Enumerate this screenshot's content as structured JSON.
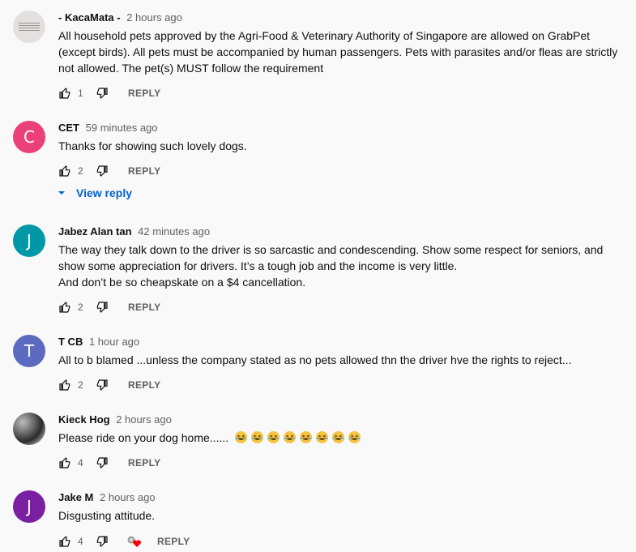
{
  "comments": [
    {
      "author": "- KacaMata -",
      "time": "2 hours ago",
      "text": "All household pets approved by the Agri-Food & Veterinary Authority of Singapore are allowed on GrabPet (except birds). All pets must be accompanied by human passengers. Pets with parasites and/or fleas are strictly not allowed. The pet(s) MUST follow the requirement",
      "likes": "1",
      "avatar": {
        "type": "image-text",
        "color": "#e3e0df"
      }
    },
    {
      "author": "CET",
      "time": "59 minutes ago",
      "text": "Thanks for showing such lovely dogs.",
      "likes": "2",
      "avatar": {
        "type": "letter",
        "letter": "C",
        "color": "#ec407a"
      },
      "view_reply": "View reply"
    },
    {
      "author": "Jabez Alan tan",
      "time": "42 minutes ago",
      "text_lines": [
        "The way they talk down to the driver is so sarcastic and condescending. Show some respect for seniors, and show some appreciation for drivers. It’s a tough job and the income is very little.",
        "And don’t be so cheapskate on a $4 cancellation."
      ],
      "likes": "2",
      "avatar": {
        "type": "letter",
        "letter": "J",
        "color": "#0097a7"
      }
    },
    {
      "author": "T CB",
      "time": "1 hour ago",
      "text": "All to b blamed ...unless the company stated as no pets allowed thn the driver hve the rights to reject...",
      "likes": "2",
      "avatar": {
        "type": "letter",
        "letter": "T",
        "color": "#5c6bc0"
      }
    },
    {
      "author": "Kieck Hog",
      "time": "2 hours ago",
      "text": "Please ride on your dog home......",
      "emoji_count": 8,
      "emoji_name": "grinning-squinting-face-emoji",
      "likes": "4",
      "avatar": {
        "type": "photo",
        "color": "#555555"
      }
    },
    {
      "author": "Jake M",
      "time": "2 hours ago",
      "text": "Disgusting attitude.",
      "likes": "4",
      "creator_heart": true,
      "avatar": {
        "type": "letter",
        "letter": "J",
        "color": "#7b1fa2"
      }
    }
  ],
  "reply_label": "REPLY",
  "icons": {
    "like": "thumbs-up-icon",
    "dislike": "thumbs-down-icon",
    "chevron": "chevron-down-icon",
    "heart": "creator-heart-icon"
  },
  "colors": {
    "link": "#065fd4",
    "secondary_text": "#606060",
    "heart": "#ff0000"
  }
}
